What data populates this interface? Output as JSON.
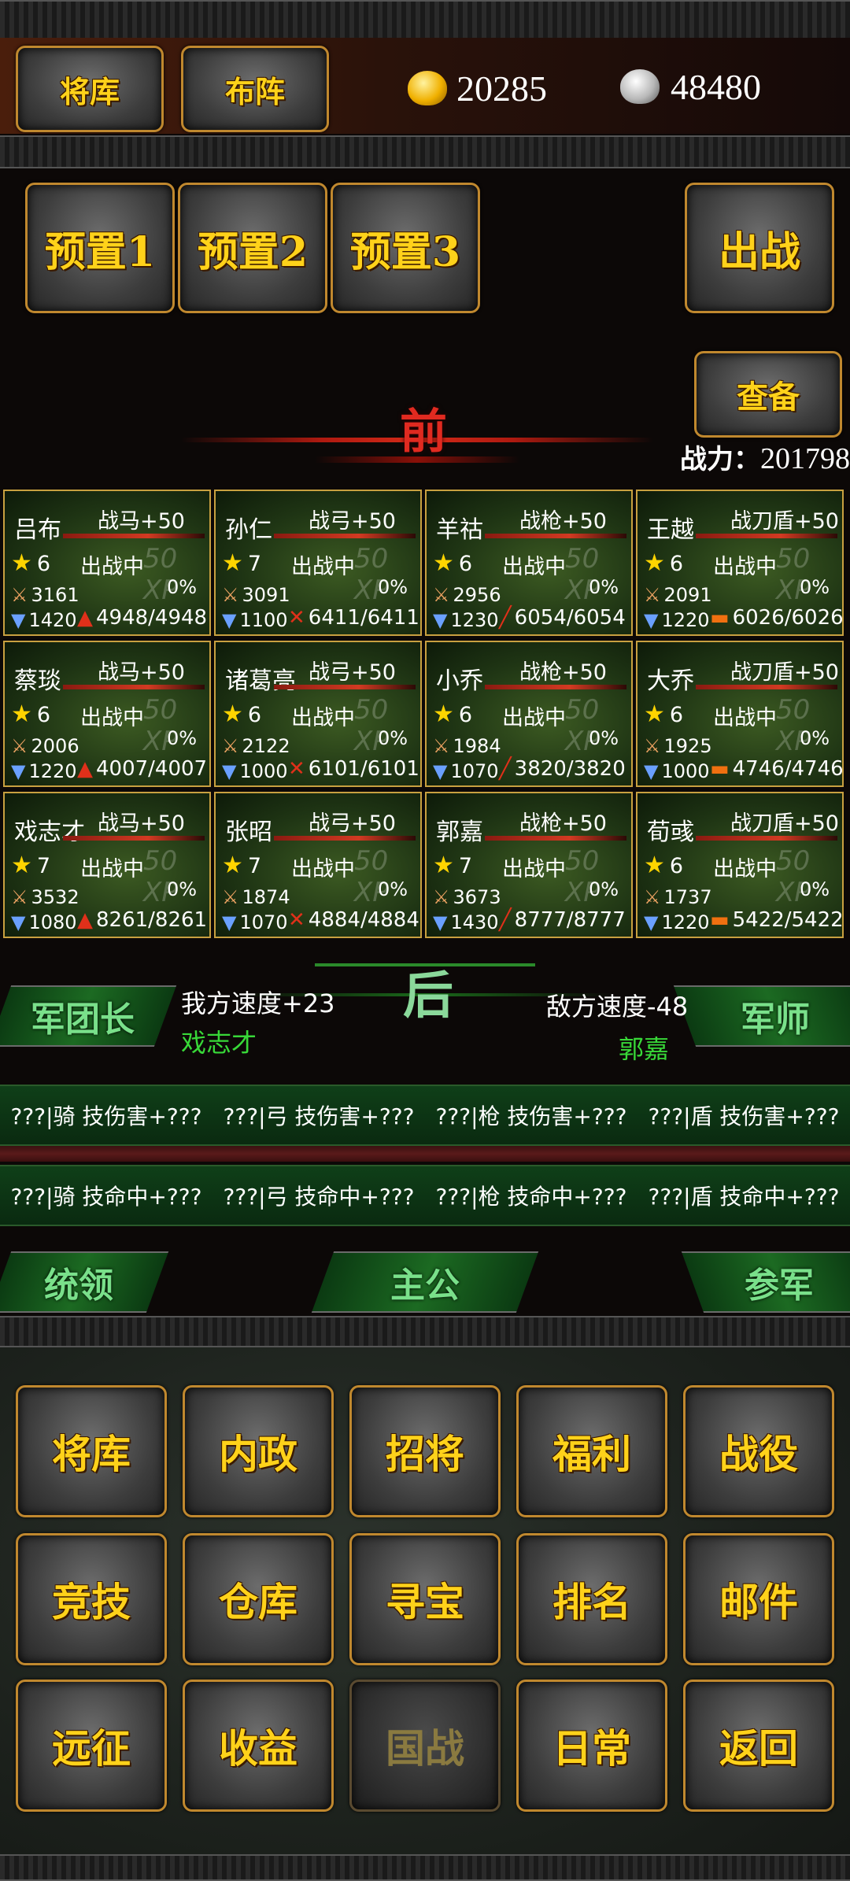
{
  "top_tabs": {
    "generals": "将库",
    "formation": "布阵"
  },
  "currency": {
    "gold": "20285",
    "silver": "48480"
  },
  "presets": [
    "预置1",
    "预置2",
    "预置3"
  ],
  "deploy_label": "出战",
  "inspect_label": "查备",
  "front_label": "前",
  "rear_label": "后",
  "power_label": "战力：",
  "power_value": "201798",
  "generals": [
    {
      "name": "吕布",
      "equip": "战马+50",
      "stars": "6",
      "status": "出战中",
      "xp": "0%",
      "atk": "3161",
      "def": "1420",
      "hp": "4948/4948",
      "type": "cavalry"
    },
    {
      "name": "孙仁",
      "equip": "战弓+50",
      "stars": "7",
      "status": "出战中",
      "xp": "0%",
      "atk": "3091",
      "def": "1100",
      "hp": "6411/6411",
      "type": "archer"
    },
    {
      "name": "羊祜",
      "equip": "战枪+50",
      "stars": "6",
      "status": "出战中",
      "xp": "0%",
      "atk": "2956",
      "def": "1230",
      "hp": "6054/6054",
      "type": "spear"
    },
    {
      "name": "王越",
      "equip": "战刀盾+50",
      "stars": "6",
      "status": "出战中",
      "xp": "0%",
      "atk": "2091",
      "def": "1220",
      "hp": "6026/6026",
      "type": "shield"
    },
    {
      "name": "蔡琰",
      "equip": "战马+50",
      "stars": "6",
      "status": "出战中",
      "xp": "0%",
      "atk": "2006",
      "def": "1220",
      "hp": "4007/4007",
      "type": "cavalry"
    },
    {
      "name": "诸葛亮",
      "equip": "战弓+50",
      "stars": "6",
      "status": "出战中",
      "xp": "0%",
      "atk": "2122",
      "def": "1000",
      "hp": "6101/6101",
      "type": "archer"
    },
    {
      "name": "小乔",
      "equip": "战枪+50",
      "stars": "6",
      "status": "出战中",
      "xp": "0%",
      "atk": "1984",
      "def": "1070",
      "hp": "3820/3820",
      "type": "spear"
    },
    {
      "name": "大乔",
      "equip": "战刀盾+50",
      "stars": "6",
      "status": "出战中",
      "xp": "0%",
      "atk": "1925",
      "def": "1000",
      "hp": "4746/4746",
      "type": "shield"
    },
    {
      "name": "戏志才",
      "equip": "战马+50",
      "stars": "7",
      "status": "出战中",
      "xp": "0%",
      "atk": "3532",
      "def": "1080",
      "hp": "8261/8261",
      "type": "cavalry"
    },
    {
      "name": "张昭",
      "equip": "战弓+50",
      "stars": "7",
      "status": "出战中",
      "xp": "0%",
      "atk": "1874",
      "def": "1070",
      "hp": "4884/4884",
      "type": "archer"
    },
    {
      "name": "郭嘉",
      "equip": "战枪+50",
      "stars": "7",
      "status": "出战中",
      "xp": "0%",
      "atk": "3673",
      "def": "1430",
      "hp": "8777/8777",
      "type": "spear"
    },
    {
      "name": "荀彧",
      "equip": "战刀盾+50",
      "stars": "6",
      "status": "出战中",
      "xp": "0%",
      "atk": "1737",
      "def": "1220",
      "hp": "5422/5422",
      "type": "shield"
    }
  ],
  "xp_watermark": "XP",
  "level_watermark": "50",
  "legion_leader_label": "军团长",
  "advisor_label": "军师",
  "our_speed": "我方速度+23",
  "our_leader": "戏志才",
  "enemy_speed": "敌方速度-48",
  "enemy_advisor": "郭嘉",
  "skill_damage": [
    "???|骑 技伤害+???",
    "???|弓 技伤害+???",
    "???|枪 技伤害+???",
    "???|盾 技伤害+???"
  ],
  "skill_hit": [
    "???|骑 技命中+???",
    "???|弓 技命中+???",
    "???|枪 技命中+???",
    "???|盾 技命中+???"
  ],
  "lower_banners": {
    "command": "统领",
    "lord": "主公",
    "staff": "参军"
  },
  "menu": [
    [
      "将库",
      "内政",
      "招将",
      "福利",
      "战役"
    ],
    [
      "竞技",
      "仓库",
      "寻宝",
      "排名",
      "邮件"
    ],
    [
      "远征",
      "收益",
      "国战",
      "日常",
      "返回"
    ]
  ],
  "colors": {
    "gold": "#ffd21a",
    "border": "#c0882e",
    "card_border": "#c8a040",
    "banner_green": "#1c6a22",
    "hp_red": "#e0301a",
    "green_name": "#38d838"
  }
}
